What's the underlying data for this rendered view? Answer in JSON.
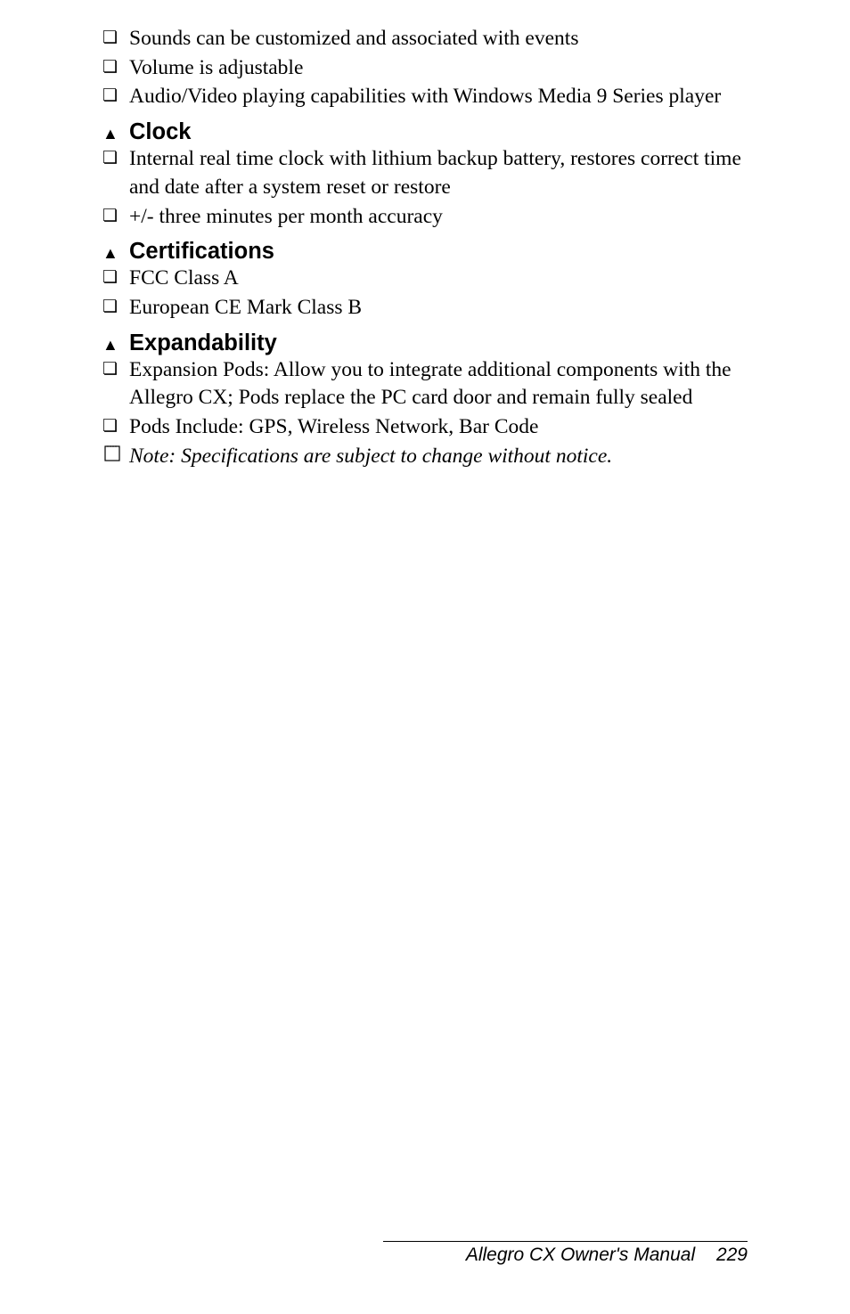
{
  "bullets_top": [
    "Sounds can be customized and associated with events",
    "Volume is adjustable",
    "Audio/Video playing capabilities with Windows Media 9 Series player"
  ],
  "section_clock": {
    "title": "Clock",
    "items": [
      "Internal real time clock with lithium backup battery, restores correct time and date after a system reset or restore",
      "+/- three minutes per month accuracy"
    ]
  },
  "section_cert": {
    "title": "Certifications",
    "items": [
      "FCC Class A",
      "European CE Mark Class B"
    ]
  },
  "section_expand": {
    "title": "Expandability",
    "items": [
      "Expansion Pods: Allow you to integrate additional components with the Allegro CX; Pods replace the PC card door and remain fully sealed",
      "Pods Include: GPS, Wireless Network, Bar Code"
    ]
  },
  "note": "Note: Specifications are subject to change without notice.",
  "footer": {
    "title": "Allegro CX Owner's Manual",
    "page": "229"
  }
}
